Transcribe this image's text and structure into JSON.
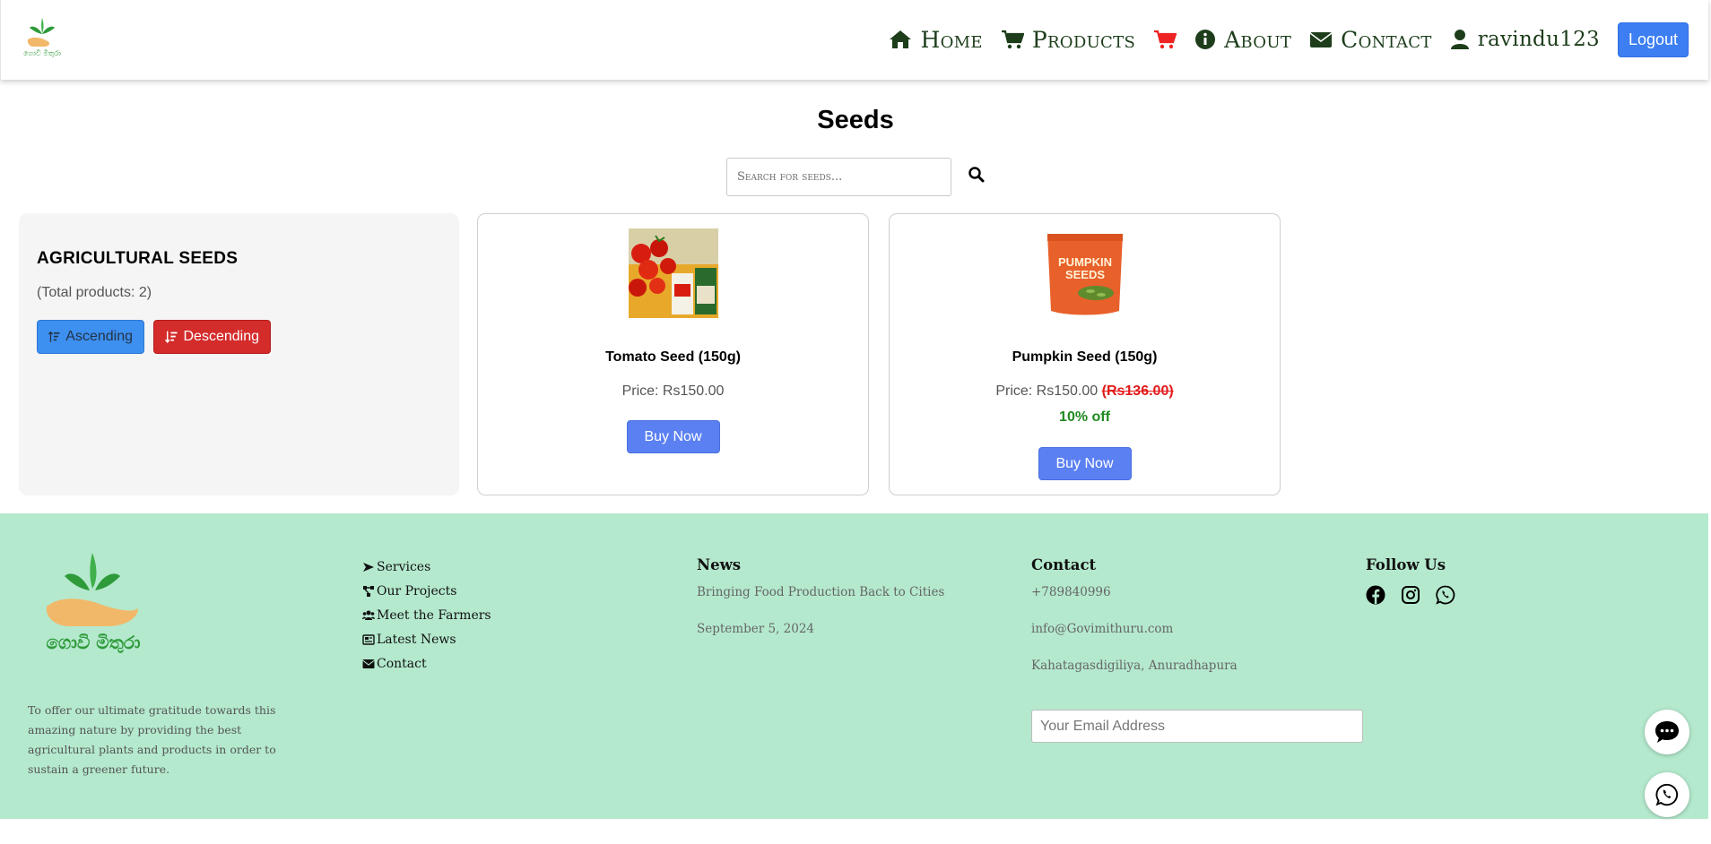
{
  "nav": {
    "logo_alt": "ගොවි මිතුරා",
    "home": "Home",
    "products": "Products",
    "about": "About",
    "contact": "Contact",
    "user": "ravindu123",
    "logout": "Logout"
  },
  "page": {
    "title": "Seeds"
  },
  "search": {
    "placeholder": "Search for seeds..."
  },
  "sidebar": {
    "category": "AGRICULTURAL SEEDS",
    "total": "(Total products: 2)",
    "ascending": "Ascending",
    "descending": "Descending"
  },
  "products": [
    {
      "name": "Tomato Seed (150g)",
      "price_label": "Price: Rs150.00",
      "buy": "Buy Now"
    },
    {
      "name": "Pumpkin Seed (150g)",
      "price_label": "Price: Rs150.00",
      "old_price": "(Rs136.00)",
      "discount": "10% off",
      "buy": "Buy Now"
    }
  ],
  "footer": {
    "logo_text": "ගොවි මිතුරා",
    "mission": "To offer our ultimate gratitude towards this amazing nature by providing the best agricultural plants and products in order to sustain a greener future.",
    "links": [
      "Services",
      "Our Projects",
      "Meet the Farmers",
      "Latest News",
      "Contact"
    ],
    "news_heading": "News",
    "news_title": "Bringing Food Production Back to Cities",
    "news_date": "September 5, 2024",
    "contact_heading": "Contact",
    "phone": "+789840996",
    "email": "info@Govimithuru.com",
    "address": "Kahatagasdigiliya, Anuradhapura",
    "email_placeholder": "Your Email Address",
    "follow_heading": "Follow Us"
  },
  "colors": {
    "accent_blue": "#3d7ff3",
    "danger_red": "#d42b2b",
    "footer_green": "#b4e9cd",
    "nav_text": "#1d3d1b",
    "discount_green": "#1f8b1f"
  }
}
